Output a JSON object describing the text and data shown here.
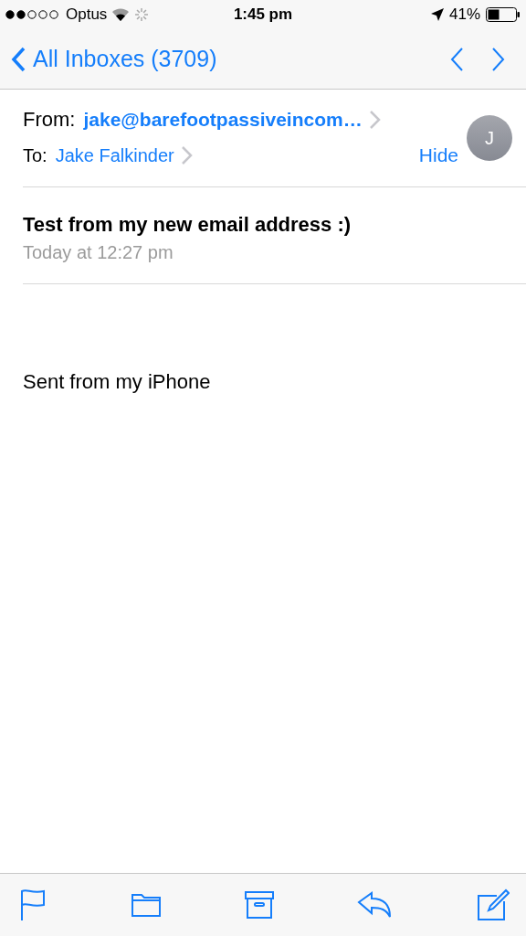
{
  "status_bar": {
    "carrier": "Optus",
    "time": "1:45 pm",
    "battery": "41%"
  },
  "nav": {
    "back": "All Inboxes (3709)"
  },
  "header": {
    "from_label": "From:",
    "from": "jake@barefootpassiveincom…",
    "to_label": "To:",
    "to": "Jake Falkinder",
    "hide": "Hide",
    "avatar": "J"
  },
  "subject": "Test from my new email address :)",
  "date": "Today at 12:27 pm",
  "body": "Sent from my iPhone",
  "toolbar": [
    {
      "kind": "flag"
    },
    {
      "kind": "folder"
    },
    {
      "kind": "archive"
    },
    {
      "kind": "reply"
    },
    {
      "kind": "compose"
    }
  ]
}
